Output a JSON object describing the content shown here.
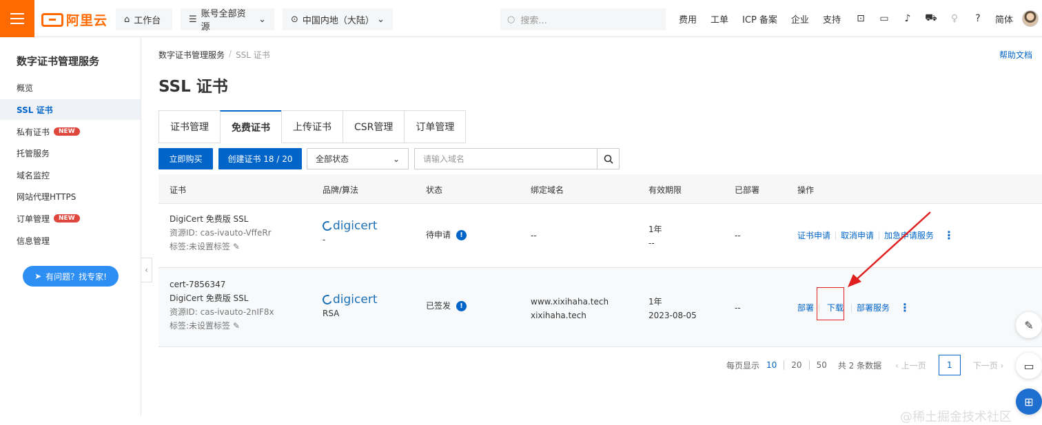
{
  "topbar": {
    "logo": "阿里云",
    "workbench": "工作台",
    "resources": "账号全部资源",
    "region": "中国内地（大陆）",
    "search_placeholder": "搜索...",
    "links": [
      "费用",
      "工单",
      "ICP 备案",
      "企业",
      "支持"
    ],
    "lang": "简体"
  },
  "sidebar": {
    "title": "数字证书管理服务",
    "items": [
      {
        "label": "概览",
        "badge": ""
      },
      {
        "label": "SSL 证书",
        "badge": ""
      },
      {
        "label": "私有证书",
        "badge": "NEW"
      },
      {
        "label": "托管服务",
        "badge": ""
      },
      {
        "label": "域名监控",
        "badge": ""
      },
      {
        "label": "网站代理HTTPS",
        "badge": ""
      },
      {
        "label": "订单管理",
        "badge": "NEW"
      },
      {
        "label": "信息管理",
        "badge": ""
      }
    ],
    "help_button": "有问题？找专家!"
  },
  "main": {
    "breadcrumb": [
      "数字证书管理服务",
      "SSL 证书"
    ],
    "help_doc": "帮助文档",
    "title": "SSL 证书",
    "tabs": [
      "证书管理",
      "免费证书",
      "上传证书",
      "CSR管理",
      "订单管理"
    ],
    "buy_button": "立即购买",
    "create_button": "创建证书 18 / 20",
    "status_select": "全部状态",
    "domain_placeholder": "请输入域名"
  },
  "table": {
    "headers": [
      "证书",
      "品牌/算法",
      "状态",
      "绑定域名",
      "有效期限",
      "已部署",
      "操作"
    ],
    "rows": [
      {
        "name": "",
        "product": "DigiCert 免费版 SSL",
        "resource": "资源ID: cas-ivauto-VffeRr",
        "tag": "标签:未设置标签",
        "brand": "digicert",
        "algo": "-",
        "status": "待申请",
        "domains": [
          "--"
        ],
        "validity": [
          "1年",
          "--"
        ],
        "deployed": "--",
        "ops": [
          "证书申请",
          "取消申请",
          "加急申请服务"
        ]
      },
      {
        "name": "cert-7856347",
        "product": "DigiCert 免费版 SSL",
        "resource": "资源ID: cas-ivauto-2nIF8x",
        "tag": "标签:未设置标签",
        "brand": "digicert",
        "algo": "RSA",
        "status": "已签发",
        "domains": [
          "www.xixihaha.tech",
          "xixihaha.tech"
        ],
        "validity": [
          "1年",
          "2023-08-05"
        ],
        "deployed": "--",
        "ops": [
          "部署",
          "下载",
          "部署服务"
        ]
      }
    ]
  },
  "pager": {
    "per_page_label": "每页显示",
    "sizes": [
      "10",
      "20",
      "50"
    ],
    "total": "共 2 条数据",
    "prev": "上一页",
    "current": "1",
    "next": "下一页"
  },
  "watermark": "@稀土掘金技术社区",
  "colors": {
    "brand": "#ff6a00",
    "primary": "#0064c8",
    "highlight": "#e02020"
  }
}
